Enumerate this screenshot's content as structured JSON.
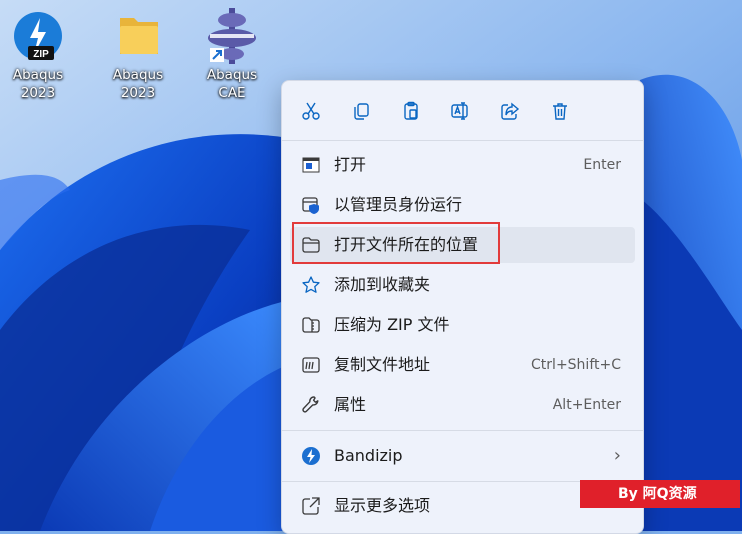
{
  "desktop": {
    "icons": [
      {
        "label": "Abaqus\n2023",
        "icon": "zip-archive-icon"
      },
      {
        "label": "Abaqus\n2023",
        "icon": "folder-icon"
      },
      {
        "label": "Abaqus CAE",
        "icon": "abaqus-cae-shortcut-icon"
      }
    ]
  },
  "context_menu": {
    "toolbar": [
      {
        "name": "cut",
        "icon": "scissors-icon"
      },
      {
        "name": "copy",
        "icon": "copy-icon"
      },
      {
        "name": "paste",
        "icon": "clipboard-icon"
      },
      {
        "name": "rename",
        "icon": "rename-icon"
      },
      {
        "name": "share",
        "icon": "share-icon"
      },
      {
        "name": "delete",
        "icon": "trash-icon"
      }
    ],
    "items": [
      {
        "label": "打开",
        "shortcut": "Enter",
        "icon": "open-window-icon"
      },
      {
        "label": "以管理员身份运行",
        "shortcut": "",
        "icon": "admin-shield-icon"
      },
      {
        "label": "打开文件所在的位置",
        "shortcut": "",
        "icon": "folder-open-icon",
        "highlighted": true
      },
      {
        "label": "添加到收藏夹",
        "shortcut": "",
        "icon": "star-icon"
      },
      {
        "label": "压缩为 ZIP 文件",
        "shortcut": "",
        "icon": "zip-folder-icon"
      },
      {
        "label": "复制文件地址",
        "shortcut": "Ctrl+Shift+C",
        "icon": "copy-path-icon"
      },
      {
        "label": "属性",
        "shortcut": "Alt+Enter",
        "icon": "wrench-icon"
      },
      {
        "label": "Bandizip",
        "shortcut": "›",
        "icon": "bandizip-icon"
      },
      {
        "label": "显示更多选项",
        "shortcut": "",
        "icon": "more-options-icon"
      }
    ]
  },
  "watermark": {
    "text": "By 阿Q资源"
  },
  "colors": {
    "accent": "#0067c0",
    "highlight_border": "#e23b3b",
    "watermark_bg": "#e0202a"
  }
}
